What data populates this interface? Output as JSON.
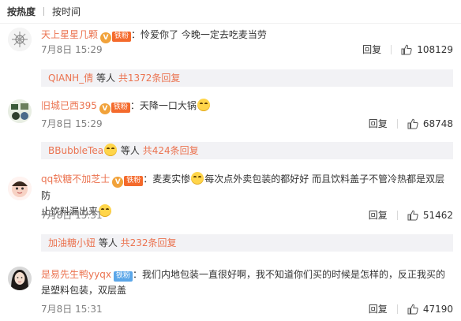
{
  "sort": {
    "hot": "按热度",
    "time": "按时间"
  },
  "comments": [
    {
      "user": "天上星星几颗",
      "badge": "铁粉",
      "text_a": "：怜爱你了 今晚一定去吃麦当劳",
      "time": "7月8日 15:29",
      "reply": "回复",
      "likes": "108129",
      "sub": {
        "user": "QIANH_倩",
        "others": " 等人 ",
        "total": "共1372条回复"
      }
    },
    {
      "user": "旧城已西395",
      "badge": "铁粉",
      "text_a": "：天降一口大锅",
      "time": "7月8日 15:29",
      "reply": "回复",
      "likes": "68748",
      "sub": {
        "user": "BBubbleTea",
        "others": " 等人 ",
        "total": "共424条回复"
      }
    },
    {
      "user": "qq软糖不加芝士",
      "badge": "铁粉",
      "text_a": "：麦麦实惨",
      "text_b": "每次点外卖包装的都好好 而且饮料盖子不管冷热都是双层防",
      "text_c": "止饮料漏出来",
      "time": "7月8日 15:31",
      "reply": "回复",
      "likes": "51462",
      "sub": {
        "user": "加油糖小妞",
        "others": " 等人 ",
        "total": "共232条回复"
      }
    },
    {
      "user": "是易先生鸭yyqx",
      "badge": "铁粉",
      "text_a": "：我们内地包装一直很好啊，我不知道你们买的时候是怎样的，反正我买的",
      "text_b": "是塑料包装，双层盖",
      "time": "7月8日 15:31",
      "reply": "回复",
      "likes": "47190"
    }
  ]
}
